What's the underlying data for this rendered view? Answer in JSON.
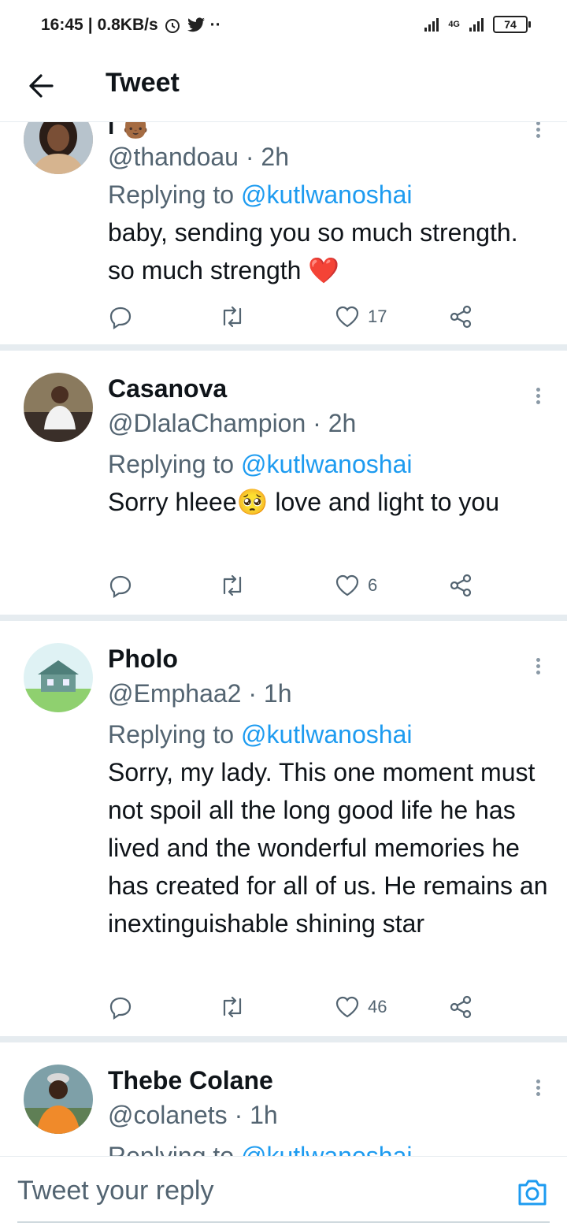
{
  "status_bar": {
    "time": "16:45",
    "speed": "0.8KB/s",
    "network": "4G",
    "battery": "74"
  },
  "header": {
    "title": "Tweet"
  },
  "tweets": [
    {
      "name": "",
      "handle": "@thandoau",
      "time": "2h",
      "replying_prefix": "Replying to ",
      "replying_to": "@kutlwanoshai",
      "text": "baby, sending you so much strength. so much strength ❤️",
      "likes": "17",
      "avatar_color": "#c9a58a"
    },
    {
      "name": "Casanova",
      "handle": "@DlalaChampion",
      "time": "2h",
      "replying_prefix": "Replying to ",
      "replying_to": "@kutlwanoshai",
      "text": "Sorry hleee🥺 love and light to you",
      "likes": "6",
      "avatar_color": "#6b5a4a"
    },
    {
      "name": "Pholo",
      "handle": "@Emphaa2",
      "time": "1h",
      "replying_prefix": "Replying to ",
      "replying_to": "@kutlwanoshai",
      "text": "Sorry, my lady. This one moment must not spoil all the long good life he has lived and the wonderful memories he has created for all of us. He remains an inextinguishable shining star",
      "likes": "46",
      "avatar_color": "#8fd0a8"
    },
    {
      "name": "Thebe Colane",
      "handle": "@colanets",
      "time": "1h",
      "replying_prefix": "Replying to ",
      "replying_to": "@kutlwanoshai",
      "avatar_color": "#e07a2a"
    }
  ],
  "reply_bar": {
    "placeholder": "Tweet your reply"
  },
  "colors": {
    "accent": "#1d9bf0",
    "muted": "#536471",
    "divider": "#e6ecf0"
  }
}
